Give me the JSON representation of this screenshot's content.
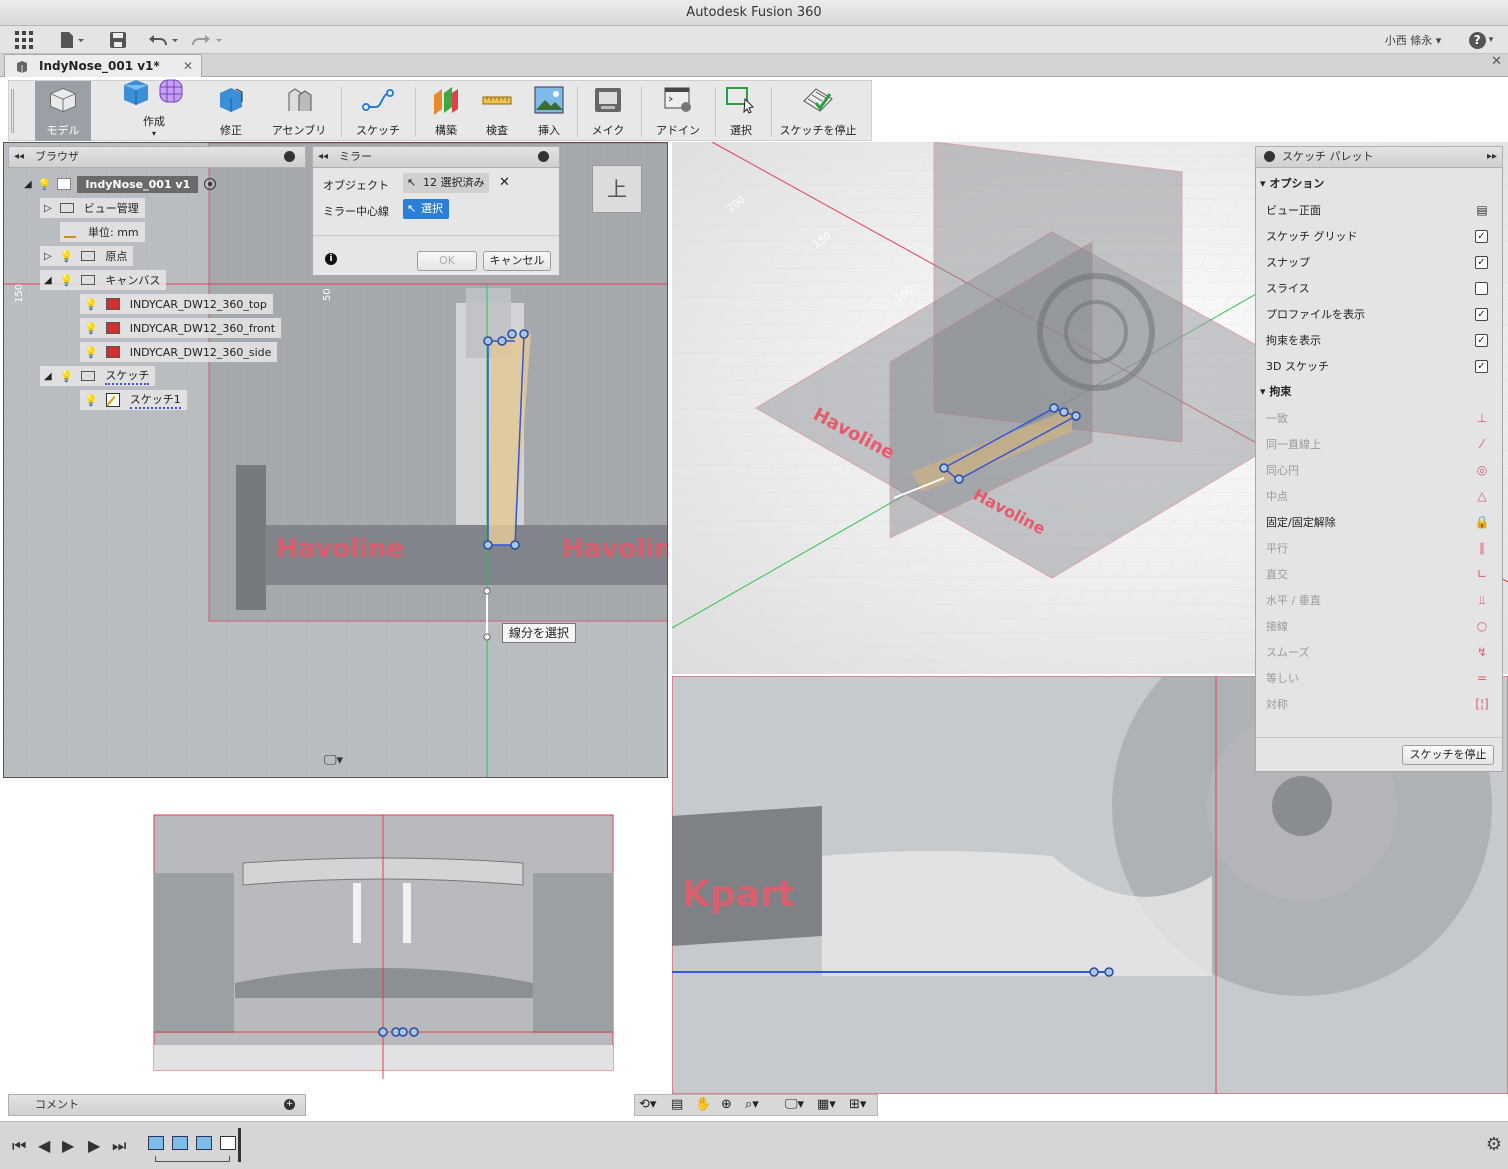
{
  "app": {
    "title": "Autodesk Fusion 360"
  },
  "quick_access": {
    "user": "小西 條永 ▾",
    "help": "?"
  },
  "document_tab": {
    "label": "IndyNose_001 v1*",
    "close": "✕"
  },
  "toolbar": {
    "workspace": "モデル",
    "create": "作成",
    "modify": "修正",
    "assemble": "アセンブリ",
    "sketch": "スケッチ",
    "construct": "構築",
    "inspect": "検査",
    "insert": "挿入",
    "make": "メイク",
    "addins": "アドイン",
    "select": "選択",
    "stop_sketch": "スケッチを停止"
  },
  "browser": {
    "title": "ブラウザ",
    "root": "IndyNose_001 v1",
    "items": [
      {
        "label": "ビュー管理"
      },
      {
        "label": "単位: mm"
      },
      {
        "label": "原点"
      },
      {
        "label": "キャンバス"
      },
      {
        "label": "INDYCAR_DW12_360_top"
      },
      {
        "label": "INDYCAR_DW12_360_front"
      },
      {
        "label": "INDYCAR_DW12_360_side"
      },
      {
        "label": "スケッチ"
      },
      {
        "label": "スケッチ1"
      }
    ]
  },
  "mirror_dialog": {
    "title": "ミラー",
    "object_label": "オブジェクト",
    "object_value": "12 選択済み",
    "mirror_line_label": "ミラー中心線",
    "mirror_line_value": "選択",
    "ok": "OK",
    "cancel": "キャンセル"
  },
  "viewcube": {
    "label": "上"
  },
  "viewport_top": {
    "scale_left": "150",
    "scale_mid": "50",
    "logo_left": "Havoline",
    "logo_right": "Havoline",
    "tooltip": "線分を選択"
  },
  "viewport_3d": {
    "scale_a": "150",
    "scale_b": "100",
    "scale_c": "200"
  },
  "sketch_palette": {
    "title": "スケッチ パレット",
    "options_header": "オプション",
    "options": [
      {
        "label": "ビュー正面",
        "checked": null
      },
      {
        "label": "スケッチ グリッド",
        "checked": true
      },
      {
        "label": "スナップ",
        "checked": true
      },
      {
        "label": "スライス",
        "checked": false
      },
      {
        "label": "プロファイルを表示",
        "checked": true
      },
      {
        "label": "拘束を表示",
        "checked": true
      },
      {
        "label": "3D スケッチ",
        "checked": true
      }
    ],
    "constraints_header": "拘束",
    "constraints": [
      {
        "label": "一致",
        "enabled": false,
        "icon": "coincident-icon"
      },
      {
        "label": "同一直線上",
        "enabled": false,
        "icon": "collinear-icon"
      },
      {
        "label": "同心円",
        "enabled": false,
        "icon": "concentric-icon"
      },
      {
        "label": "中点",
        "enabled": false,
        "icon": "midpoint-icon"
      },
      {
        "label": "固定/固定解除",
        "enabled": true,
        "icon": "lock-icon"
      },
      {
        "label": "平行",
        "enabled": false,
        "icon": "parallel-icon"
      },
      {
        "label": "直交",
        "enabled": false,
        "icon": "perpendicular-icon"
      },
      {
        "label": "水平 / 垂直",
        "enabled": false,
        "icon": "horizontal-vertical-icon"
      },
      {
        "label": "接線",
        "enabled": false,
        "icon": "tangent-icon"
      },
      {
        "label": "スムーズ",
        "enabled": false,
        "icon": "smooth-icon"
      },
      {
        "label": "等しい",
        "enabled": false,
        "icon": "equal-icon"
      },
      {
        "label": "対称",
        "enabled": false,
        "icon": "symmetry-icon"
      }
    ],
    "stop_button": "スケッチを停止"
  },
  "comment": {
    "title": "コメント"
  },
  "colors": {
    "accent": "#2a7fd4",
    "sketch_line": "#3355dd",
    "axis_red": "#e04050",
    "axis_green": "#30c050"
  }
}
